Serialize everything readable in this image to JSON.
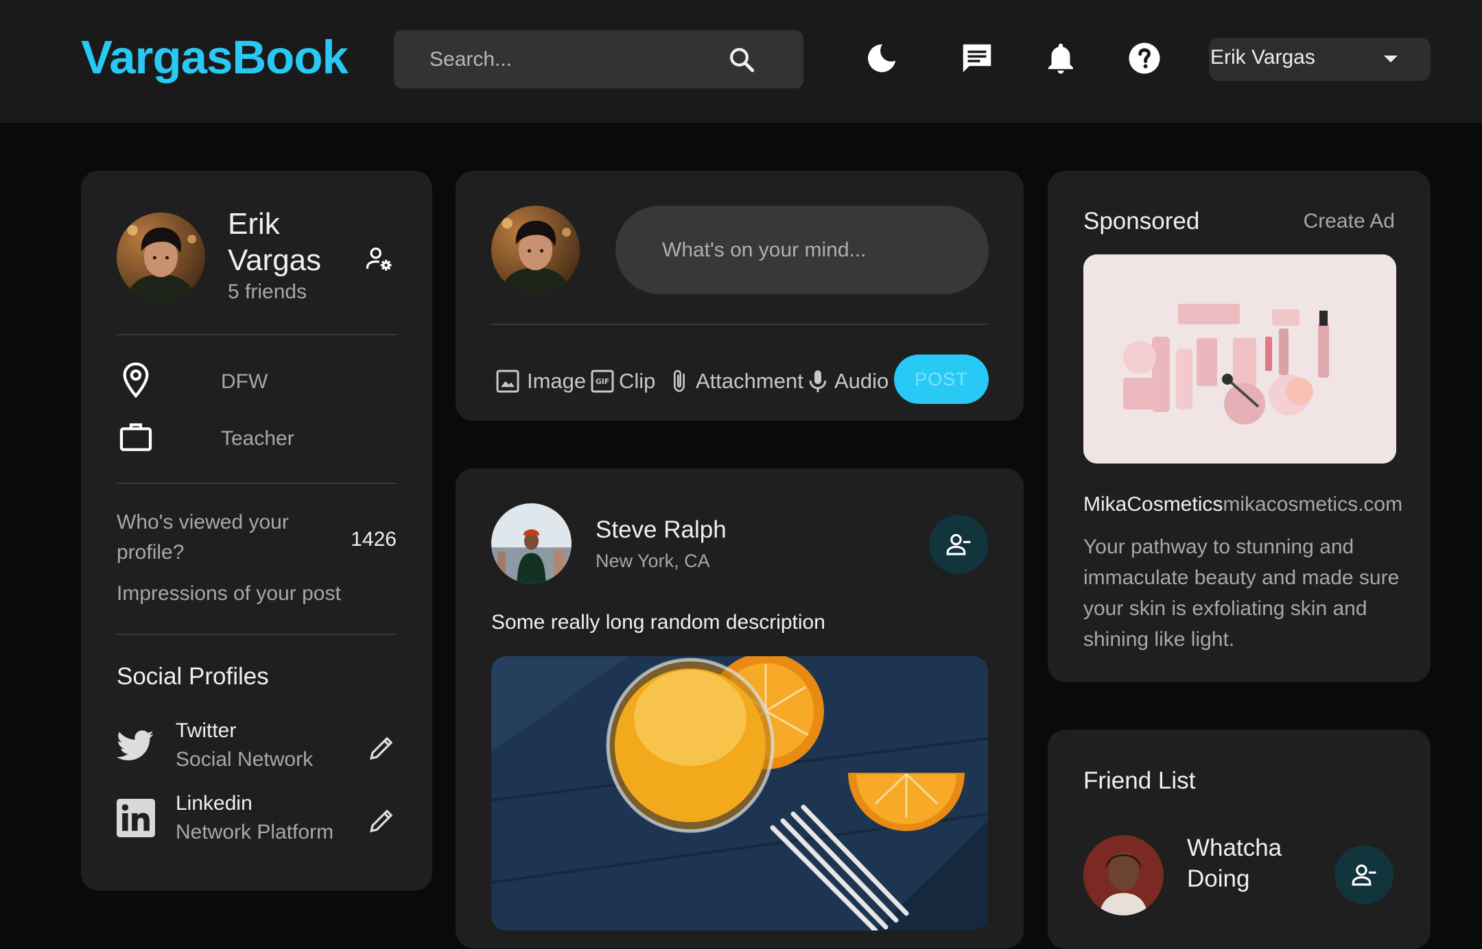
{
  "header": {
    "logo": "VargasBook",
    "search_placeholder": "Search...",
    "user_name": "Erik Vargas",
    "icons": [
      "moon-icon",
      "message-icon",
      "bell-icon",
      "help-icon",
      "caret-down-icon"
    ]
  },
  "profile": {
    "name": "Erik Vargas",
    "friends": "5 friends",
    "location": "DFW",
    "occupation": "Teacher",
    "viewed_label": "Who's viewed your profile?",
    "viewed_value": "1426",
    "impressions_label": "Impressions of your post",
    "social_title": "Social Profiles",
    "social": [
      {
        "name": "Twitter",
        "type": "Social Network",
        "icon": "twitter-icon"
      },
      {
        "name": "Linkedin",
        "type": "Network Platform",
        "icon": "linkedin-icon"
      }
    ]
  },
  "compose": {
    "placeholder": "What's on your mind...",
    "tools": [
      {
        "label": "Image",
        "icon": "image-icon"
      },
      {
        "label": "Clip",
        "icon": "gif-icon"
      },
      {
        "label": "Attachment",
        "icon": "paperclip-icon"
      },
      {
        "label": "Audio",
        "icon": "mic-icon"
      }
    ],
    "post_label": "POST"
  },
  "post": {
    "author": "Steve Ralph",
    "location": "New York, CA",
    "description": "Some really long random description"
  },
  "sponsored": {
    "title": "Sponsored",
    "create_ad": "Create Ad",
    "brand": "MikaCosmetics",
    "url": "mikacosmetics.com",
    "text": "Your pathway to stunning and immaculate beauty and made sure your skin is exfoliating skin and shining like light."
  },
  "friend_list": {
    "title": "Friend List",
    "friends": [
      {
        "name": "Whatcha Doing"
      }
    ]
  },
  "colors": {
    "accent": "#29c9f5",
    "background": "#0a0a0a",
    "card": "#1f1f1f",
    "navbar": "#1a1a1a"
  }
}
